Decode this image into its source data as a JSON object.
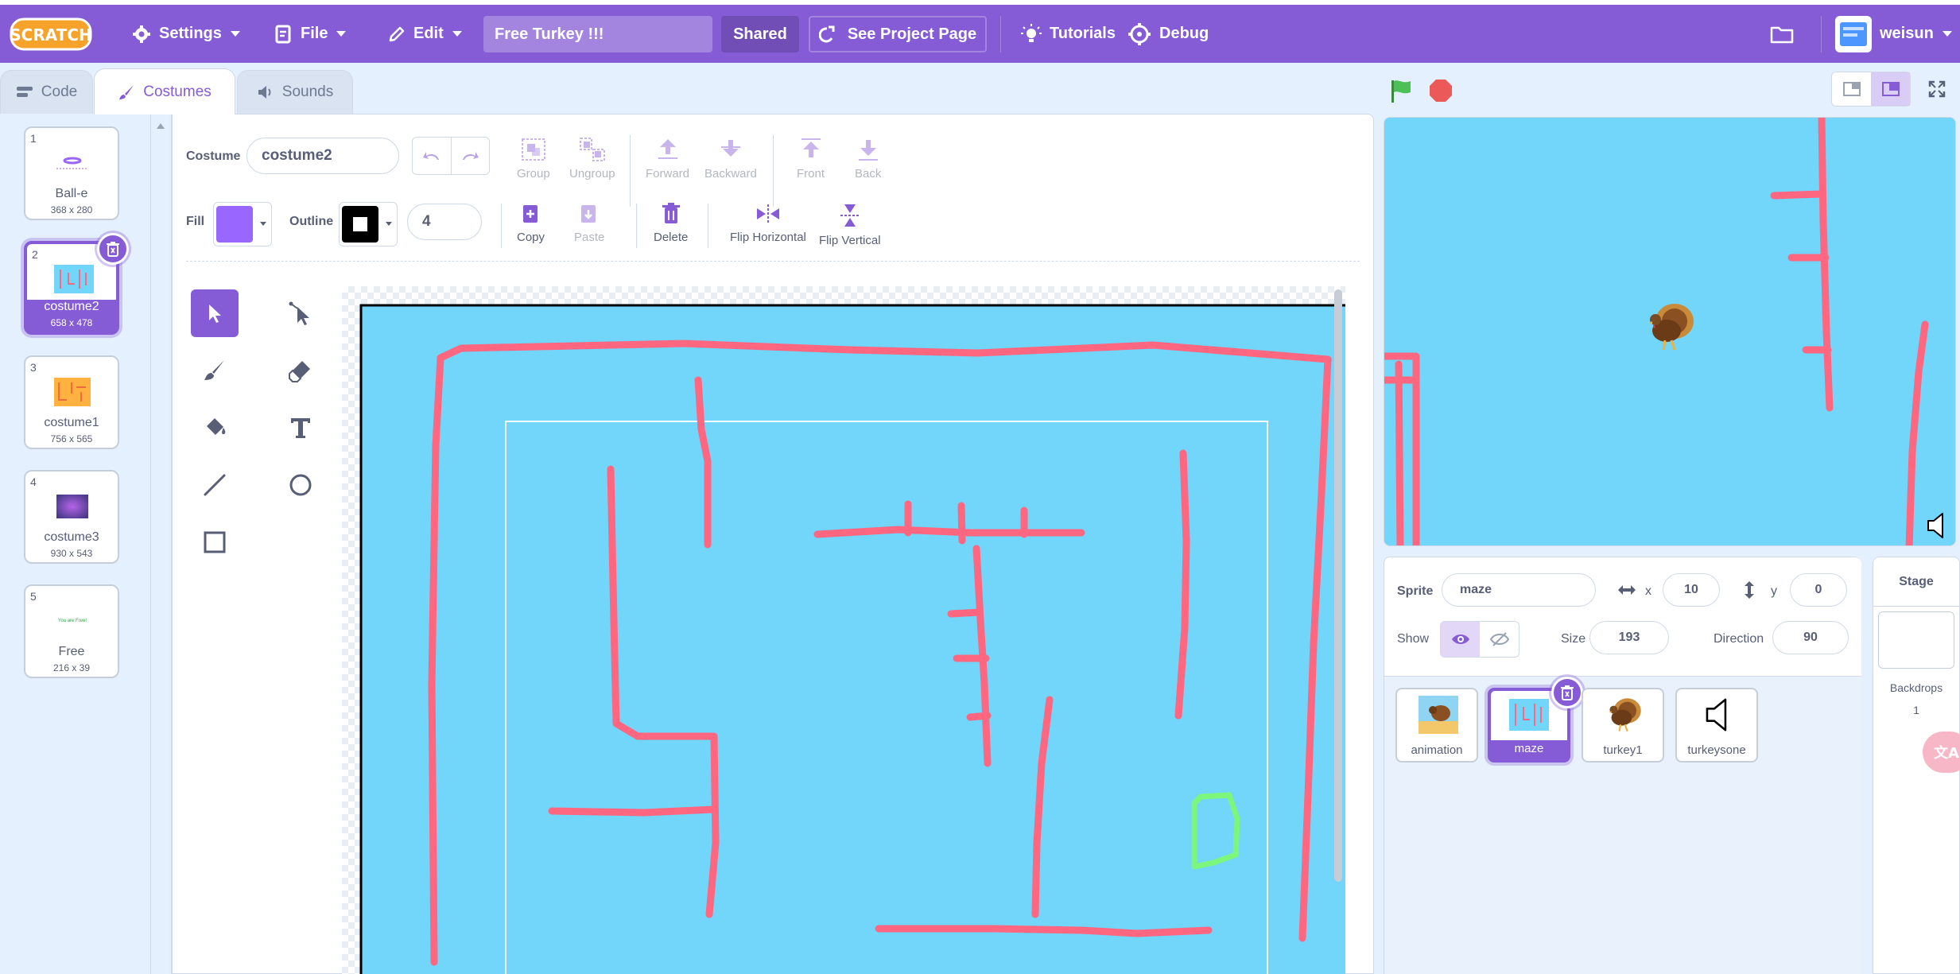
{
  "menubar": {
    "logo_text": "SCRATCH",
    "settings": "Settings",
    "file": "File",
    "edit": "Edit",
    "project_title": "Free Turkey !!!",
    "shared": "Shared",
    "see_project_page": "See Project Page",
    "tutorials": "Tutorials",
    "debug": "Debug",
    "username": "weisun",
    "accent": "#855cd6"
  },
  "tabs": {
    "code": "Code",
    "costumes": "Costumes",
    "sounds": "Sounds"
  },
  "costumes": [
    {
      "num": "1",
      "name": "Ball-e",
      "dim": "368 x 280"
    },
    {
      "num": "2",
      "name": "costume2",
      "dim": "658 x 478"
    },
    {
      "num": "3",
      "name": "costume1",
      "dim": "756 x 565"
    },
    {
      "num": "4",
      "name": "costume3",
      "dim": "930 x 543"
    },
    {
      "num": "5",
      "name": "Free",
      "dim": "216 x 39"
    }
  ],
  "editor": {
    "costume_label": "Costume",
    "costume_name": "costume2",
    "group": "Group",
    "ungroup": "Ungroup",
    "forward": "Forward",
    "backward": "Backward",
    "front": "Front",
    "back": "Back",
    "fill_label": "Fill",
    "outline_label": "Outline",
    "outline_width": "4",
    "copy": "Copy",
    "paste": "Paste",
    "delete": "Delete",
    "flip_h": "Flip Horizontal",
    "flip_v": "Flip Vertical",
    "fill_color": "#9966ff",
    "outline_color": "#000000"
  },
  "sprite_info": {
    "sprite_label": "Sprite",
    "sprite_name": "maze",
    "x_label": "x",
    "x": "10",
    "y_label": "y",
    "y": "0",
    "show_label": "Show",
    "size_label": "Size",
    "size": "193",
    "direction_label": "Direction",
    "direction": "90"
  },
  "sprites": [
    {
      "name": "animation"
    },
    {
      "name": "maze"
    },
    {
      "name": "turkey1"
    },
    {
      "name": "turkeysone"
    }
  ],
  "stage_pane": {
    "title": "Stage",
    "backdrops_label": "Backdrops",
    "backdrops_count": "1"
  },
  "free_costume_text": "You are Free!",
  "translate_text": "文A"
}
